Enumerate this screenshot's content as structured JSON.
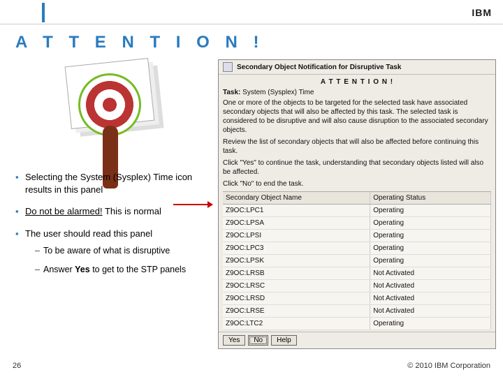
{
  "header": {
    "brand": "IBM"
  },
  "title": "A T T E N T I O N !",
  "bullets": {
    "b1": "Selecting the System (Sysplex) Time icon results in this panel",
    "b2a": "Do not be alarmed!",
    "b2b": " This is normal",
    "b3": "The user should read this panel",
    "sub1": "To be aware of what is disruptive",
    "sub2a": "Answer ",
    "sub2b": "Yes",
    "sub2c": " to get to the STP panels"
  },
  "panel": {
    "title": "Secondary Object Notification for Disruptive Task",
    "attention": "A T T E N T I O N !",
    "task_label": "Task:",
    "task_value": "System (Sysplex) Time",
    "para1": "One or more of the objects to be targeted for the selected task have associated secondary objects that will also be affected by this task. The selected task is considered to be disruptive and will also cause disruption to the associated secondary objects.",
    "para2": "Review the list of secondary objects that will also be affected before continuing this task.",
    "para3": "Click \"Yes\" to continue the task, understanding that secondary objects listed will also be affected.",
    "para4": "Click \"No\" to end the task.",
    "columns": [
      "Secondary Object Name",
      "Operating Status"
    ],
    "rows": [
      [
        "Z9OC:LPC1",
        "Operating"
      ],
      [
        "Z9OC:LPSA",
        "Operating"
      ],
      [
        "Z9OC:LPSI",
        "Operating"
      ],
      [
        "Z9OC:LPC3",
        "Operating"
      ],
      [
        "Z9OC:LPSK",
        "Operating"
      ],
      [
        "Z9OC:LRSB",
        "Not Activated"
      ],
      [
        "Z9OC:LRSC",
        "Not Activated"
      ],
      [
        "Z9OC:LRSD",
        "Not Activated"
      ],
      [
        "Z9OC:LRSE",
        "Not Activated"
      ],
      [
        "Z9OC:LTC2",
        "Operating"
      ]
    ],
    "buttons": {
      "yes": "Yes",
      "no": "No",
      "help": "Help"
    }
  },
  "footer": {
    "page": "26",
    "copyright": "© 2010 IBM Corporation"
  }
}
